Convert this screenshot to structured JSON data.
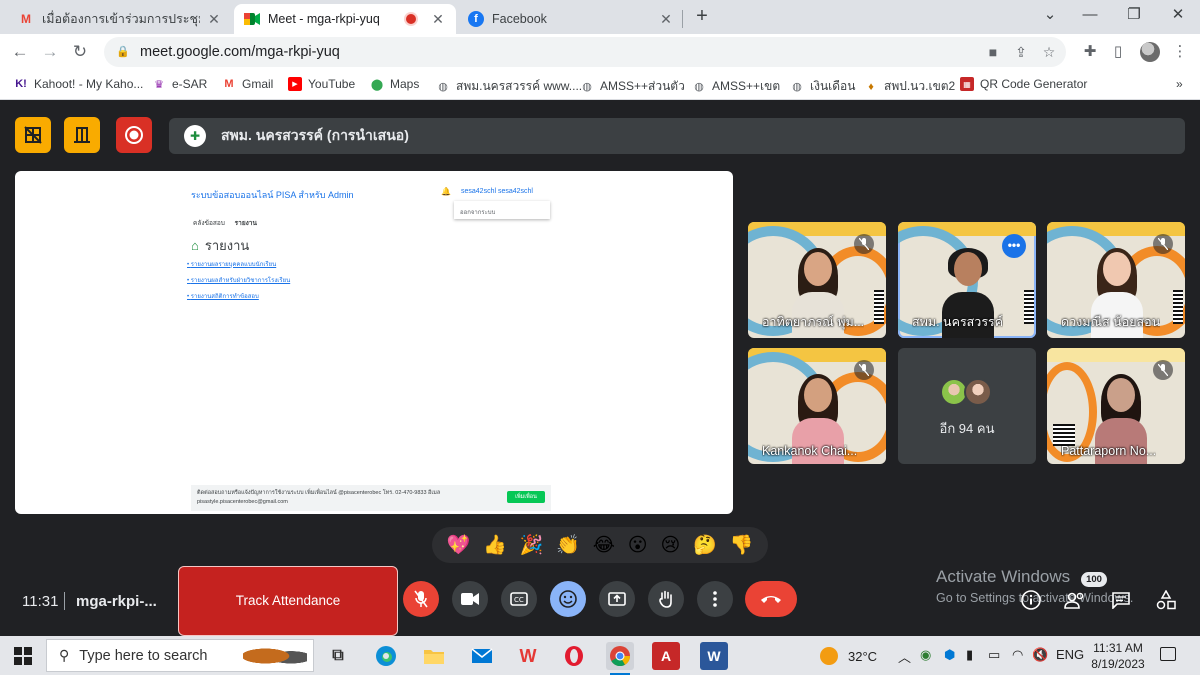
{
  "browser": {
    "tabs": [
      {
        "title": "เมื่อต้องการเข้าร่วมการประชุมทางวิดีโอ",
        "icon": "gmail-icon",
        "active": false
      },
      {
        "title": "Meet - mga-rkpi-yuq",
        "icon": "meet-icon",
        "active": true
      },
      {
        "title": "Facebook",
        "icon": "facebook-icon",
        "active": false
      }
    ],
    "url": "meet.google.com/mga-rkpi-yuq",
    "bookmarks": [
      {
        "label": "Kahoot! - My Kaho...",
        "icon": "kahoot-icon"
      },
      {
        "label": "e-SAR",
        "icon": "esar-icon"
      },
      {
        "label": "Gmail",
        "icon": "gmail-icon"
      },
      {
        "label": "YouTube",
        "icon": "youtube-icon"
      },
      {
        "label": "Maps",
        "icon": "maps-icon"
      },
      {
        "label": "สพม.นครสวรรค์ www....",
        "icon": "globe-icon"
      },
      {
        "label": "AMSS++ส่วนตัว",
        "icon": "globe-icon"
      },
      {
        "label": "AMSS++เขต",
        "icon": "globe-icon"
      },
      {
        "label": "เงินเดือน",
        "icon": "globe-icon"
      },
      {
        "label": "สพป.นว.เขต2",
        "icon": "obec-icon"
      },
      {
        "label": "QR Code Generator",
        "icon": "qr-icon"
      }
    ],
    "bookmarks_more": "»"
  },
  "meet": {
    "presentation_title": "สพม. นครสวรรค์ (การนำเสนอ)",
    "shared_screen": {
      "site_title": "ระบบข้อสอบออนไลน์ PISA สำหรับ Admin",
      "user": "sesa42schl sesa42schl",
      "dropdown_item": "ออกจากระบบ",
      "breadcrumb": [
        "คลังข้อสอบ",
        "รายงาน"
      ],
      "heading": "รายงาน",
      "links": [
        "รายงานผลรายบุคคลแบบนักเรียน",
        "รายงานผลสำหรับฝ่ายวิชาการโรงเรียน",
        "รายงานสถิติการทำข้อสอบ"
      ],
      "footer_line1": "ติดต่อสอบถามหรือแจ้งปัญหาการใช้งานระบบ เพิ่มเพื่อนไลน์ @pisacenterobec โทร. 02-470-9833 อีเมล",
      "footer_line2": "pisastyle.pisacenterobec@gmail.com",
      "footer_button": "เพิ่มเพื่อน"
    },
    "participants": [
      {
        "name": "อาทิตยาภรณ์ พุ่ม...",
        "muted": true
      },
      {
        "name": "สพม. นครสวรรค์",
        "muted": false,
        "speaking": true
      },
      {
        "name": "ดวงมณีส น้อยสอน",
        "muted": true
      },
      {
        "name": "Kankanok Chai...",
        "muted": true
      },
      {
        "name": "Pattaraporn No...",
        "muted": true
      }
    ],
    "others_label": "อีก 94 คน",
    "reactions": [
      "💖",
      "👍",
      "🎉",
      "👏",
      "😂",
      "😮",
      "😢",
      "🤔",
      "👎"
    ],
    "time": "11:31",
    "meeting_code": "mga-rkpi-...",
    "track_attendance": "Track Attendance",
    "participant_count": "100",
    "watermark_title": "Activate Windows",
    "watermark_sub": "Go to Settings to activate Windows."
  },
  "taskbar": {
    "search_placeholder": "Type here to search",
    "temperature": "32°C",
    "language": "ENG",
    "time": "11:31 AM",
    "date": "8/19/2023"
  },
  "colors": {
    "accent_blue": "#8ab4f8",
    "danger_red": "#ea4335",
    "track_red": "#c5221f",
    "topbar_yellow": "#f9ab00"
  }
}
